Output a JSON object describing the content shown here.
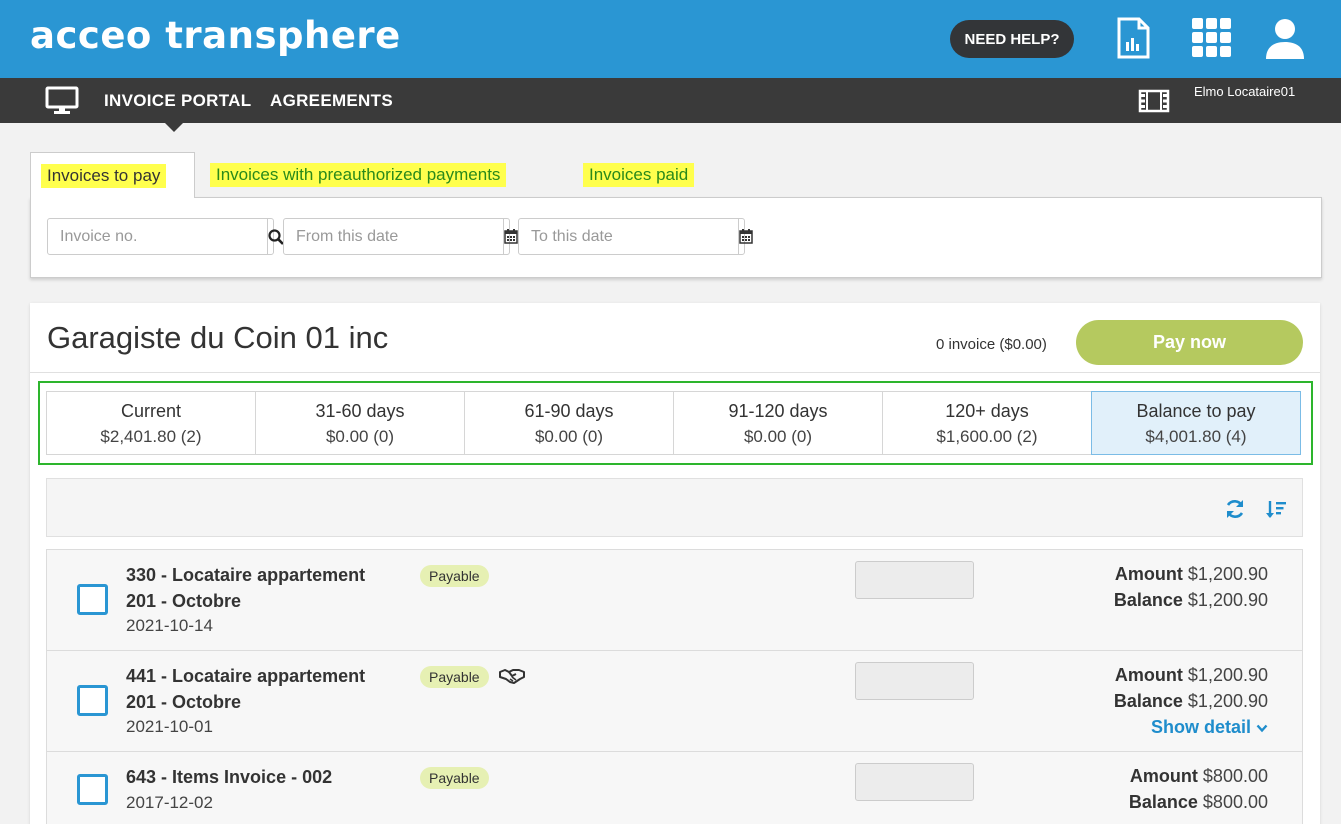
{
  "header": {
    "logo": "acceo transphere",
    "help_label": "NEED HELP?",
    "icons": [
      "report-document-icon",
      "apps-grid-icon",
      "user-profile-icon"
    ]
  },
  "nav": {
    "items": [
      {
        "label": "INVOICE PORTAL"
      },
      {
        "label": "AGREEMENTS"
      }
    ],
    "user_name": "Elmo Locataire01"
  },
  "tabs": [
    {
      "label": "Invoices to pay",
      "active": true
    },
    {
      "label": "Invoices with preauthorized payments",
      "active": false
    },
    {
      "label": "Invoices paid",
      "active": false
    }
  ],
  "filters": {
    "invoice_placeholder": "Invoice no.",
    "from_placeholder": "From this date",
    "to_placeholder": "To this date"
  },
  "vendor": {
    "name": "Garagiste du Coin 01 inc",
    "selected_summary": "0 invoice ($0.00)",
    "pay_label": "Pay now"
  },
  "aging": [
    {
      "label": "Current",
      "value": "$2,401.80 (2)"
    },
    {
      "label": "31-60 days",
      "value": "$0.00 (0)"
    },
    {
      "label": "61-90 days",
      "value": "$0.00 (0)"
    },
    {
      "label": "91-120 days",
      "value": "$0.00 (0)"
    },
    {
      "label": "120+ days",
      "value": "$1,600.00 (2)"
    },
    {
      "label": "Balance to pay",
      "value": "$4,001.80 (4)",
      "selected": true
    }
  ],
  "invoices": [
    {
      "title_line1": "330 - Locataire appartement",
      "title_line2": "201 - Octobre",
      "date": "2021-10-14",
      "status": "Payable",
      "amount_label": "Amount",
      "amount": "$1,200.90",
      "balance_label": "Balance",
      "balance": "$1,200.90"
    },
    {
      "title_line1": "441 - Locataire appartement",
      "title_line2": "201 - Octobre",
      "date": "2021-10-01",
      "status": "Payable",
      "amount_label": "Amount",
      "amount": "$1,200.90",
      "balance_label": "Balance",
      "balance": "$1,200.90",
      "detail_label": "Show detail"
    },
    {
      "title_line1": "643 - Items Invoice - 002",
      "date": "2017-12-02",
      "status": "Payable",
      "amount_label": "Amount",
      "amount": "$800.00",
      "balance_label": "Balance",
      "balance": "$800.00"
    }
  ],
  "colors": {
    "header_blue": "#2a96d3",
    "nav_dark": "#3a3a3a",
    "pay_green": "#b5c95f",
    "highlight_yellow": "#ffff4d",
    "link_blue": "#1f8dcc"
  }
}
